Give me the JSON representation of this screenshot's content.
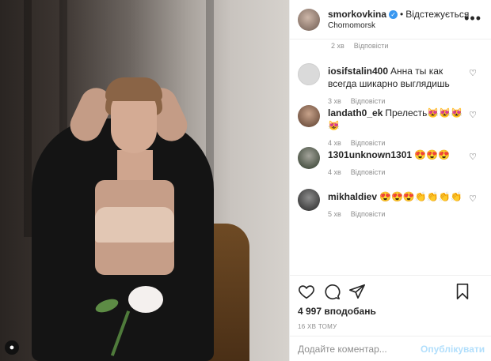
{
  "post": {
    "username": "smorkovkina",
    "follow_state": "Відстежується",
    "location": "Chornomorsk",
    "separator": "•",
    "more_icon": "more-horizontal-icon"
  },
  "comments_cut_meta": {
    "time": "2 хв",
    "reply": "Відповісти"
  },
  "comments": [
    {
      "user": "iosifstalin400",
      "text": "Анна ты как всегда шикарно выглядишь",
      "time": "3 хв",
      "reply": "Відповісти"
    },
    {
      "user": "landath0_ek",
      "text": "Прелесть😻😻😻😻",
      "time": "4 хв",
      "reply": "Відповісти"
    },
    {
      "user": "1301unknown1301",
      "text": "😍😍😍",
      "time": "4 хв",
      "reply": "Відповісти"
    },
    {
      "user": "mikhaldiev",
      "text": "😍😍😍👏👏👏👏",
      "time": "5 хв",
      "reply": "Відповісти"
    }
  ],
  "load_more_icon": "plus-circle-icon",
  "actions": {
    "icons": [
      "heart-icon",
      "comment-icon",
      "share-icon",
      "bookmark-icon"
    ],
    "likes": "4 997 вподобань",
    "time": "16 ХВ ТОМУ"
  },
  "add_comment": {
    "placeholder": "Додайте коментар...",
    "publish": "Опублікувати"
  },
  "colors": {
    "text": "#262626",
    "muted": "#8e8e8e",
    "verified": "#3897f0",
    "publish_disabled": "#b2dffc",
    "border": "#efefef"
  }
}
